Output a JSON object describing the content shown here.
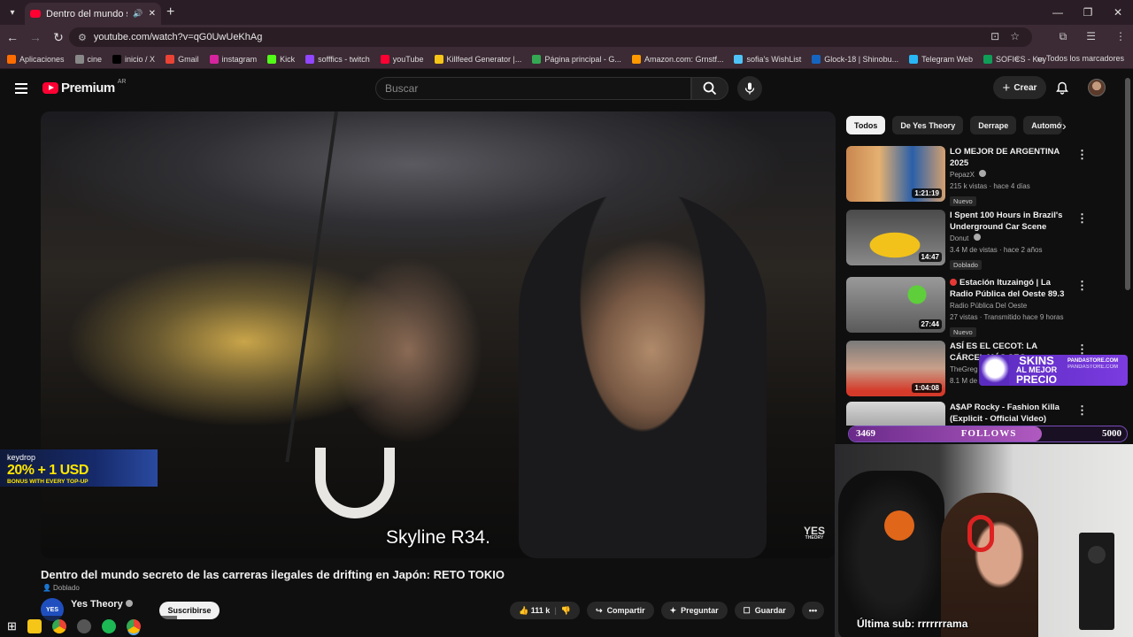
{
  "browser": {
    "tab_title": "Dentro del mundo secreto d",
    "url": "youtube.com/watch?v=qG0UwUeKhAg",
    "bookmarks": [
      {
        "label": "Aplicaciones",
        "color": "#ff6d00"
      },
      {
        "label": "cine",
        "color": "#888888"
      },
      {
        "label": "inicio / X",
        "color": "#000000"
      },
      {
        "label": "Gmail",
        "color": "#ea4335"
      },
      {
        "label": "instagram",
        "color": "#d6249f"
      },
      {
        "label": "Kick",
        "color": "#53fc18"
      },
      {
        "label": "sofffics - twitch",
        "color": "#9146ff"
      },
      {
        "label": "youTube",
        "color": "#ff0033"
      },
      {
        "label": "Killfeed Generator |...",
        "color": "#f5c518"
      },
      {
        "label": "Página principal - G...",
        "color": "#34a853"
      },
      {
        "label": "Amazon.com: Grnstf...",
        "color": "#ff9900"
      },
      {
        "label": "sofia's WishList",
        "color": "#4fc3f7"
      },
      {
        "label": "Glock-18 | Shinobu...",
        "color": "#1565c0"
      },
      {
        "label": "Telegram Web",
        "color": "#29b6f6"
      },
      {
        "label": "SOFICS - Key",
        "color": "#0f9d58"
      }
    ],
    "all_bookmarks": "Todos los marcadores"
  },
  "masthead": {
    "logo_text": "Premium",
    "country": "AR",
    "search_placeholder": "Buscar",
    "create_label": "Crear"
  },
  "video": {
    "caption": "Skyline R34.",
    "watermark": "YES",
    "watermark_sub": "THEORY",
    "title": "Dentro del mundo secreto de las carreras ilegales de drifting en Japón: RETO TOKIO",
    "dubbed": "Doblado",
    "channel": "Yes Theory",
    "channel_avatar": "YES",
    "subscribe": "Suscribirse",
    "likes": "111 k",
    "share": "Compartir",
    "ask": "Preguntar",
    "save": "Guardar"
  },
  "chips": [
    "Todos",
    "De Yes Theory",
    "Derrape",
    "Automóvi"
  ],
  "recommendations": [
    {
      "title": "LO MEJOR DE ARGENTINA 2025",
      "channel": "PepazX",
      "meta": "215 k vistas · hace 4 días",
      "badge": "Nuevo",
      "duration": "1:21:19"
    },
    {
      "title": "I Spent 100 Hours in Brazil's Underground Car Scene",
      "channel": "Donut",
      "meta": "3.4 M de vistas · hace 2 años",
      "badge": "Doblado",
      "duration": "14:47"
    },
    {
      "title": "Estación Ituzaingó | La Radio Pública del Oeste 89.3",
      "channel": "Radio Pública Del Oeste",
      "meta": "27 vistas · Transmitido hace 9 horas",
      "badge": "Nuevo",
      "duration": "27:44"
    },
    {
      "title": "ASÍ ES EL CECOT: LA CÁRCEL MÁS SEG",
      "channel": "TheGreg",
      "meta": "8.1 M de v",
      "badge": "",
      "duration": "1:04:08"
    },
    {
      "title": "A$AP Rocky - Fashion Killa (Explicit - Official Video)",
      "channel": "",
      "meta": "",
      "badge": "",
      "duration": ""
    }
  ],
  "overlays": {
    "keydrop_brand": "keydrop",
    "keydrop_offer": "20% + 1 USD",
    "keydrop_sub": "BONUS WITH EVERY TOP-UP",
    "skins_line1": "SKINS",
    "skins_line2": "AL MEJOR",
    "skins_line3": "PRECIO",
    "skins_url1": "PANDASTORE.COM",
    "skins_url2": "PANDASTORE.COM",
    "follows_current": "3469",
    "follows_label": "FOLLOWS",
    "follows_goal": "5000",
    "follows_progress": 0.694,
    "last_sub": "Última sub: rrrrrrrama"
  }
}
